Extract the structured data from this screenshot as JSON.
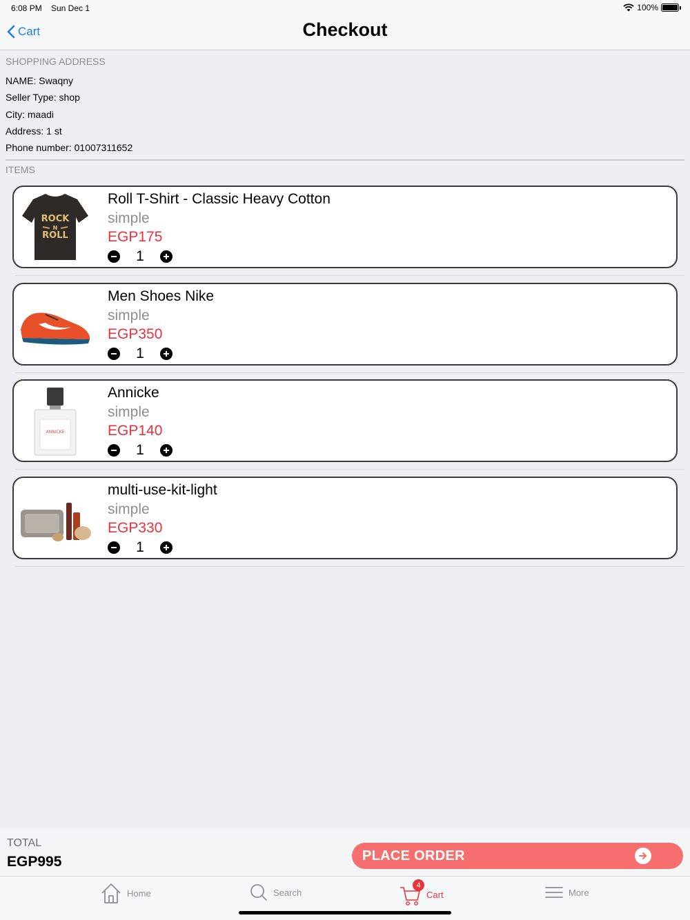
{
  "status_bar": {
    "time": "6:08 PM",
    "date": "Sun Dec 1",
    "battery": "100%"
  },
  "nav": {
    "back_label": "Cart",
    "title": "Checkout"
  },
  "address": {
    "header": "SHOPPING ADDRESS",
    "name": "NAME: Swaqny",
    "seller_type": "Seller Type: shop",
    "city": "City: maadi",
    "address": "Address: 1 st",
    "phone": "Phone number: 01007311652"
  },
  "items_header": "ITEMS",
  "items": [
    {
      "name": "Roll T-Shirt - Classic Heavy Cotton",
      "type": "simple",
      "price": "EGP175",
      "qty": "1",
      "image": "tshirt-image"
    },
    {
      "name": "Men Shoes Nike",
      "type": "simple",
      "price": "EGP350",
      "qty": "1",
      "image": "shoe-image"
    },
    {
      "name": "Annicke",
      "type": "simple",
      "price": "EGP140",
      "qty": "1",
      "image": "perfume-image"
    },
    {
      "name": "multi-use-kit-light",
      "type": "simple",
      "price": "EGP330",
      "qty": "1",
      "image": "makeup-kit-image"
    }
  ],
  "total": {
    "label": "TOTAL",
    "value": "EGP995"
  },
  "place_order": {
    "label": "PLACE ORDER"
  },
  "tabs": [
    {
      "label": "Home",
      "icon": "home-icon"
    },
    {
      "label": "Search",
      "icon": "search-icon"
    },
    {
      "label": "Cart",
      "icon": "cart-icon",
      "badge": "4"
    },
    {
      "label": "More",
      "icon": "menu-icon"
    }
  ],
  "colors": {
    "accent": "#e8323c",
    "link": "#1e7cf0",
    "order_button": "#f76e6e"
  }
}
